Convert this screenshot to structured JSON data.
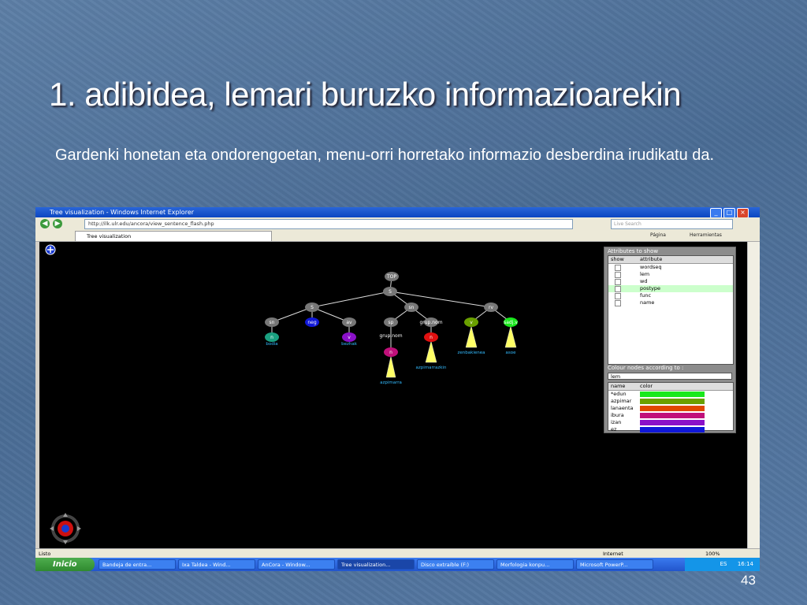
{
  "slide": {
    "title": "1. adibidea, lemari buruzko informazioarekin",
    "body": "Gardenki honetan eta ondorengoetan, menu-orri horretako informazio desberdina irudikatu da.",
    "page_number": "43"
  },
  "browser": {
    "window_title": "Tree visualization - Windows Internet Explorer",
    "address": "http://ilk.ulr.edu/ancora/view_sentence_flash.php",
    "search_placeholder": "Live Search",
    "tab_label": "Tree visualization",
    "menu_page": "Página",
    "menu_tools": "Herramientas",
    "status_left": "Listo",
    "status_zone": "Internet",
    "zoom": "100%"
  },
  "taskbar": {
    "start_label": "Inicio",
    "items": [
      "Bandeja de entra...",
      "Ixa Taldea - Wind...",
      "AnCora - Window...",
      "Tree visualization...",
      "Disco extraíble (F:)",
      "Morfologia konpu...",
      "Microsoft PowerP..."
    ],
    "language": "ES",
    "clock": "16:14"
  },
  "tree": {
    "root": "TOP",
    "nodes": [
      "S",
      "S",
      "sn",
      "rv",
      "sn",
      "neg",
      "av",
      "sp",
      "grup.nom",
      "v",
      "sadj.v",
      "grup.nom",
      "n",
      "n",
      "n",
      "v",
      "v"
    ],
    "leaves": [
      "bodia",
      "bezhak",
      "azpimarra",
      "azpimarrazkin",
      "asoe",
      "zenbakienea"
    ]
  },
  "attributes_panel": {
    "title": "Attributes to show",
    "col_show": "show",
    "col_attribute": "attribute",
    "rows": [
      "wordseq",
      "lem",
      "wd",
      "postype",
      "func",
      "name"
    ]
  },
  "colour_panel": {
    "title": "Colour nodes according to :",
    "selected": "lem",
    "col_name": "name",
    "col_color": "color",
    "rows": [
      {
        "name": "*edun",
        "color": "#19e81c"
      },
      {
        "name": "azpimar",
        "color": "#6aa000"
      },
      {
        "name": "lanaenta",
        "color": "#e04800"
      },
      {
        "name": "ibura",
        "color": "#c0107a"
      },
      {
        "name": "izan",
        "color": "#8a10c8"
      },
      {
        "name": "ez",
        "color": "#1018d8"
      }
    ]
  }
}
